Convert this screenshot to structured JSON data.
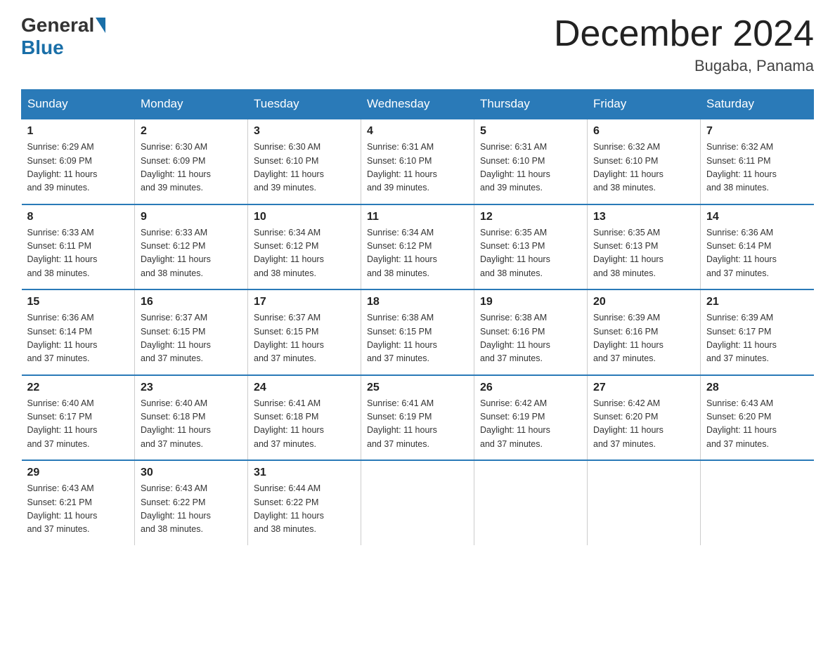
{
  "logo": {
    "general": "General",
    "blue": "Blue"
  },
  "title": "December 2024",
  "location": "Bugaba, Panama",
  "days_of_week": [
    "Sunday",
    "Monday",
    "Tuesday",
    "Wednesday",
    "Thursday",
    "Friday",
    "Saturday"
  ],
  "weeks": [
    [
      {
        "day": "1",
        "sunrise": "6:29 AM",
        "sunset": "6:09 PM",
        "daylight": "11 hours and 39 minutes."
      },
      {
        "day": "2",
        "sunrise": "6:30 AM",
        "sunset": "6:09 PM",
        "daylight": "11 hours and 39 minutes."
      },
      {
        "day": "3",
        "sunrise": "6:30 AM",
        "sunset": "6:10 PM",
        "daylight": "11 hours and 39 minutes."
      },
      {
        "day": "4",
        "sunrise": "6:31 AM",
        "sunset": "6:10 PM",
        "daylight": "11 hours and 39 minutes."
      },
      {
        "day": "5",
        "sunrise": "6:31 AM",
        "sunset": "6:10 PM",
        "daylight": "11 hours and 39 minutes."
      },
      {
        "day": "6",
        "sunrise": "6:32 AM",
        "sunset": "6:10 PM",
        "daylight": "11 hours and 38 minutes."
      },
      {
        "day": "7",
        "sunrise": "6:32 AM",
        "sunset": "6:11 PM",
        "daylight": "11 hours and 38 minutes."
      }
    ],
    [
      {
        "day": "8",
        "sunrise": "6:33 AM",
        "sunset": "6:11 PM",
        "daylight": "11 hours and 38 minutes."
      },
      {
        "day": "9",
        "sunrise": "6:33 AM",
        "sunset": "6:12 PM",
        "daylight": "11 hours and 38 minutes."
      },
      {
        "day": "10",
        "sunrise": "6:34 AM",
        "sunset": "6:12 PM",
        "daylight": "11 hours and 38 minutes."
      },
      {
        "day": "11",
        "sunrise": "6:34 AM",
        "sunset": "6:12 PM",
        "daylight": "11 hours and 38 minutes."
      },
      {
        "day": "12",
        "sunrise": "6:35 AM",
        "sunset": "6:13 PM",
        "daylight": "11 hours and 38 minutes."
      },
      {
        "day": "13",
        "sunrise": "6:35 AM",
        "sunset": "6:13 PM",
        "daylight": "11 hours and 38 minutes."
      },
      {
        "day": "14",
        "sunrise": "6:36 AM",
        "sunset": "6:14 PM",
        "daylight": "11 hours and 37 minutes."
      }
    ],
    [
      {
        "day": "15",
        "sunrise": "6:36 AM",
        "sunset": "6:14 PM",
        "daylight": "11 hours and 37 minutes."
      },
      {
        "day": "16",
        "sunrise": "6:37 AM",
        "sunset": "6:15 PM",
        "daylight": "11 hours and 37 minutes."
      },
      {
        "day": "17",
        "sunrise": "6:37 AM",
        "sunset": "6:15 PM",
        "daylight": "11 hours and 37 minutes."
      },
      {
        "day": "18",
        "sunrise": "6:38 AM",
        "sunset": "6:15 PM",
        "daylight": "11 hours and 37 minutes."
      },
      {
        "day": "19",
        "sunrise": "6:38 AM",
        "sunset": "6:16 PM",
        "daylight": "11 hours and 37 minutes."
      },
      {
        "day": "20",
        "sunrise": "6:39 AM",
        "sunset": "6:16 PM",
        "daylight": "11 hours and 37 minutes."
      },
      {
        "day": "21",
        "sunrise": "6:39 AM",
        "sunset": "6:17 PM",
        "daylight": "11 hours and 37 minutes."
      }
    ],
    [
      {
        "day": "22",
        "sunrise": "6:40 AM",
        "sunset": "6:17 PM",
        "daylight": "11 hours and 37 minutes."
      },
      {
        "day": "23",
        "sunrise": "6:40 AM",
        "sunset": "6:18 PM",
        "daylight": "11 hours and 37 minutes."
      },
      {
        "day": "24",
        "sunrise": "6:41 AM",
        "sunset": "6:18 PM",
        "daylight": "11 hours and 37 minutes."
      },
      {
        "day": "25",
        "sunrise": "6:41 AM",
        "sunset": "6:19 PM",
        "daylight": "11 hours and 37 minutes."
      },
      {
        "day": "26",
        "sunrise": "6:42 AM",
        "sunset": "6:19 PM",
        "daylight": "11 hours and 37 minutes."
      },
      {
        "day": "27",
        "sunrise": "6:42 AM",
        "sunset": "6:20 PM",
        "daylight": "11 hours and 37 minutes."
      },
      {
        "day": "28",
        "sunrise": "6:43 AM",
        "sunset": "6:20 PM",
        "daylight": "11 hours and 37 minutes."
      }
    ],
    [
      {
        "day": "29",
        "sunrise": "6:43 AM",
        "sunset": "6:21 PM",
        "daylight": "11 hours and 37 minutes."
      },
      {
        "day": "30",
        "sunrise": "6:43 AM",
        "sunset": "6:22 PM",
        "daylight": "11 hours and 38 minutes."
      },
      {
        "day": "31",
        "sunrise": "6:44 AM",
        "sunset": "6:22 PM",
        "daylight": "11 hours and 38 minutes."
      },
      null,
      null,
      null,
      null
    ]
  ],
  "labels": {
    "sunrise": "Sunrise:",
    "sunset": "Sunset:",
    "daylight": "Daylight:"
  }
}
